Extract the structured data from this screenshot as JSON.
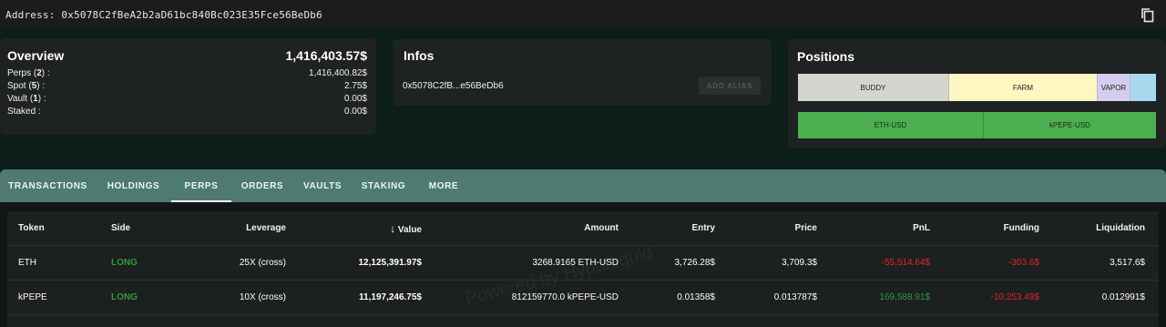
{
  "topbar": {
    "address": "Address: 0x5078C2fBeA2b2aD61bc840Bc023E35Fce56BeDb6"
  },
  "overview": {
    "title": "Overview",
    "total": "1,416,403.57$",
    "rows": [
      {
        "label_prefix": "Perps (",
        "count": "2",
        "label_suffix": ") :",
        "value": "1,416,400.82$"
      },
      {
        "label_prefix": "Spot (",
        "count": "5",
        "label_suffix": ") :",
        "value": "2.75$"
      },
      {
        "label_prefix": "Vault (",
        "count": "1",
        "label_suffix": ") :",
        "value": "0.00$"
      },
      {
        "label": "Staked :",
        "value": "0.00$"
      }
    ]
  },
  "infos": {
    "title": "Infos",
    "short_address": "0x5078C2fB...e56BeDb6",
    "alias_button": "ADD ALIAS"
  },
  "positions": {
    "title": "Positions",
    "groups": [
      "BUDDY",
      "FARM",
      "VAPOR",
      ""
    ],
    "markets": [
      "ETH-USD",
      "kPEPE-USD"
    ]
  },
  "tabs": [
    "TRANSACTIONS",
    "HOLDINGS",
    "PERPS",
    "ORDERS",
    "VAULTS",
    "STAKING",
    "MORE"
  ],
  "active_tab": "PERPS",
  "table": {
    "headers": [
      "Token",
      "Side",
      "Leverage",
      "Value",
      "Amount",
      "Entry",
      "Price",
      "PnL",
      "Funding",
      "Liquidation"
    ],
    "sort_indicator": "↓",
    "rows": [
      {
        "token": "ETH",
        "side": "LONG",
        "leverage": "25X (cross)",
        "value": "12,125,391.97$",
        "amount": "3268.9165 ETH-USD",
        "entry": "3,726.28$",
        "price": "3,709.3$",
        "pnl": "-55,514.64$",
        "funding": "-303.6$",
        "liquidation": "3,517.6$"
      },
      {
        "token": "kPEPE",
        "side": "LONG",
        "leverage": "10X (cross)",
        "value": "11,197,246.75$",
        "amount": "812159770.0 kPEPE-USD",
        "entry": "0.01358$",
        "price": "0.013787$",
        "pnl": "169,588.91$",
        "funding": "-10,253.49$",
        "liquidation": "0.012991$"
      }
    ],
    "watermark": "Powered by Hypurliquid"
  },
  "colors": {
    "accent_tab": "#4e7a72",
    "long": "#2e9b3a",
    "negative": "#e02424",
    "position_green": "#4caf50"
  }
}
